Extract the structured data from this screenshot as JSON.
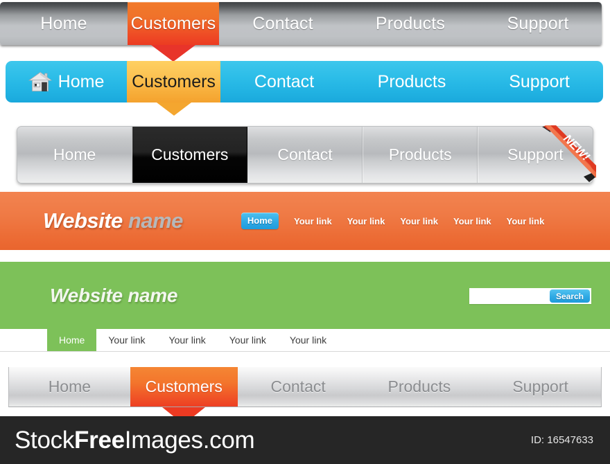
{
  "bars": {
    "bar1": {
      "name": "dark-grey-nav",
      "items": [
        {
          "label": "Home",
          "active": false
        },
        {
          "label": "Customers",
          "active": true
        },
        {
          "label": "Contact",
          "active": false
        },
        {
          "label": "Products",
          "active": false
        },
        {
          "label": "Support",
          "active": false
        }
      ],
      "accent": "#ef5126"
    },
    "bar2": {
      "name": "cyan-nav",
      "home_icon": "house-icon",
      "items": [
        {
          "label": "Home",
          "active": false
        },
        {
          "label": "Customers",
          "active": true
        },
        {
          "label": "Contact",
          "active": false
        },
        {
          "label": "Products",
          "active": false
        },
        {
          "label": "Support",
          "active": false
        }
      ],
      "bg": "#2cbde8",
      "accent": "#f7ae3a"
    },
    "bar3": {
      "name": "silver-panel-nav",
      "ribbon_label": "NEW!",
      "ribbon_color": "#e8452c",
      "items": [
        {
          "label": "Home",
          "active": false
        },
        {
          "label": "Customers",
          "active": true
        },
        {
          "label": "Contact",
          "active": false
        },
        {
          "label": "Products",
          "active": false
        },
        {
          "label": "Support",
          "active": false
        }
      ]
    },
    "bar4": {
      "name": "orange-header",
      "logo_part1": "Website",
      "logo_part2": "name",
      "bg": "#ec6b34",
      "links": [
        {
          "label": "Home",
          "active": true
        },
        {
          "label": "Your link",
          "active": false
        },
        {
          "label": "Your link",
          "active": false
        },
        {
          "label": "Your link",
          "active": false
        },
        {
          "label": "Your link",
          "active": false
        },
        {
          "label": "Your link",
          "active": false
        }
      ]
    },
    "bar5": {
      "name": "green-header",
      "logo": "Website name",
      "bg": "#7dc159",
      "search": {
        "value": "",
        "placeholder": "",
        "button_label": "Search"
      },
      "links": [
        {
          "label": "Home",
          "active": true
        },
        {
          "label": "Your link",
          "active": false
        },
        {
          "label": "Your link",
          "active": false
        },
        {
          "label": "Your link",
          "active": false
        },
        {
          "label": "Your link",
          "active": false
        }
      ]
    },
    "bar6": {
      "name": "light-silver-nav",
      "items": [
        {
          "label": "Home",
          "active": false
        },
        {
          "label": "Customers",
          "active": true
        },
        {
          "label": "Contact",
          "active": false
        },
        {
          "label": "Products",
          "active": false
        },
        {
          "label": "Support",
          "active": false
        }
      ],
      "accent": "#f05527"
    }
  },
  "footer": {
    "brand_part1": "Stock",
    "brand_part2": "Free",
    "brand_part3": "Images.com",
    "id_label": "ID: 16547633",
    "bg": "#262626"
  }
}
